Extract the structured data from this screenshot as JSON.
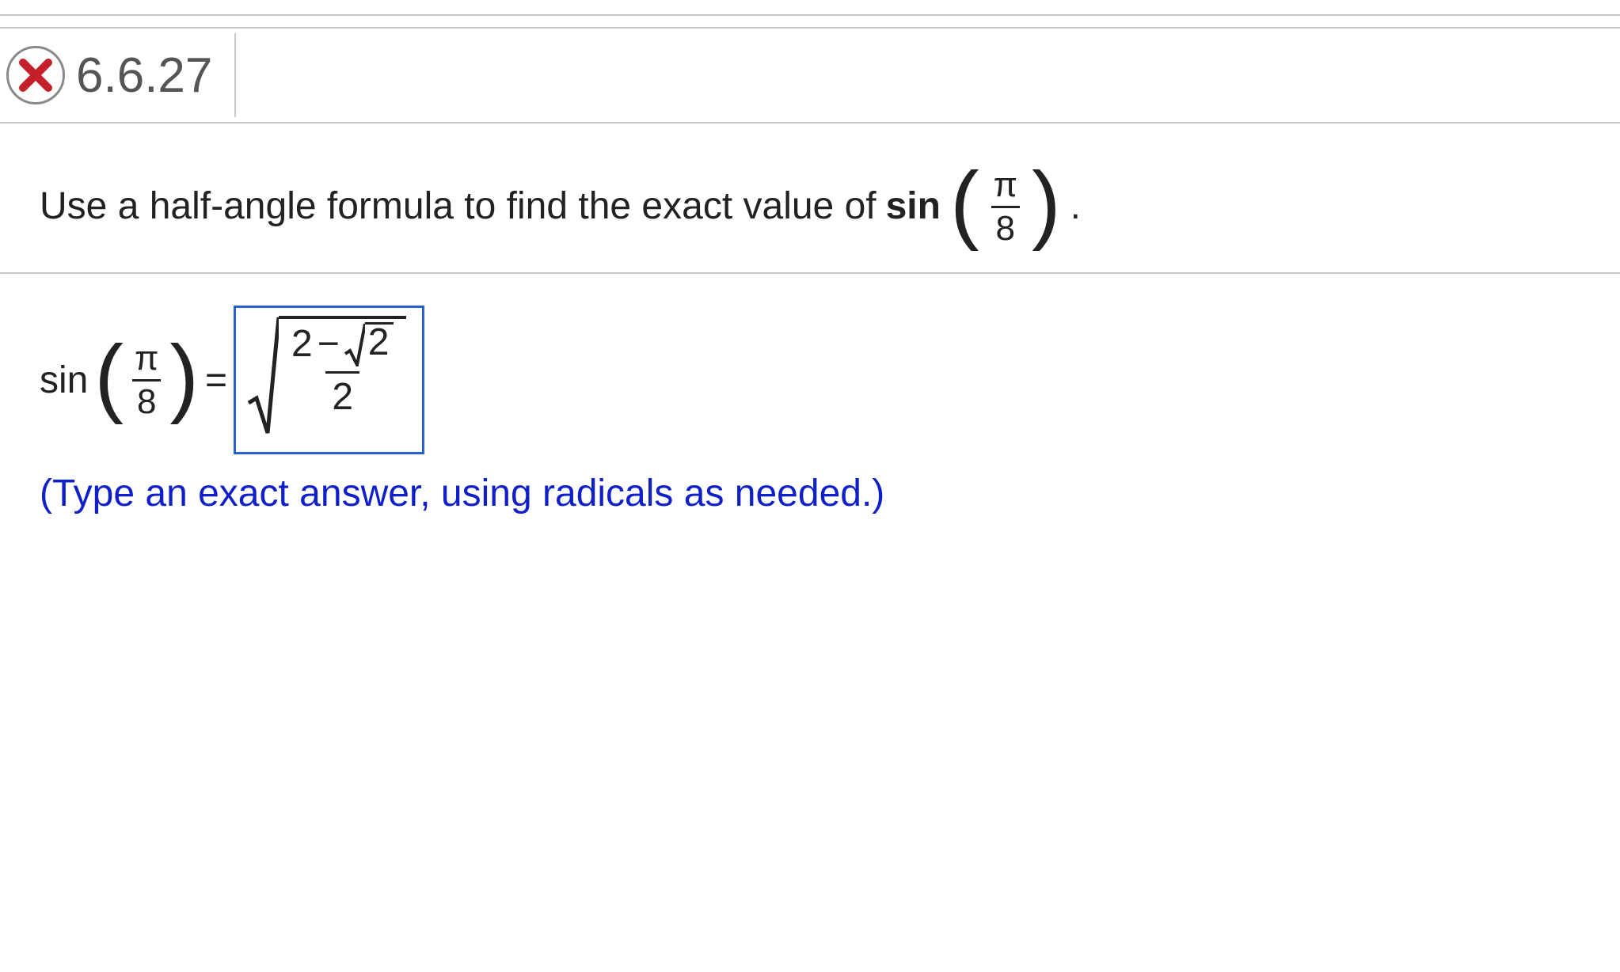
{
  "header": {
    "status": "incorrect",
    "question_number": "6.6.27"
  },
  "question": {
    "prefix": "Use a half-angle formula to find the exact value of",
    "fn": "sin",
    "arg_num": "π",
    "arg_den": "8",
    "suffix": "."
  },
  "answer": {
    "fn": "sin",
    "arg_num": "π",
    "arg_den": "8",
    "equals": "=",
    "inner_num_left": "2",
    "inner_minus": "−",
    "inner_sqrt_val": "2",
    "inner_den": "2"
  },
  "instruction": "(Type an exact answer, using radicals as needed.)"
}
